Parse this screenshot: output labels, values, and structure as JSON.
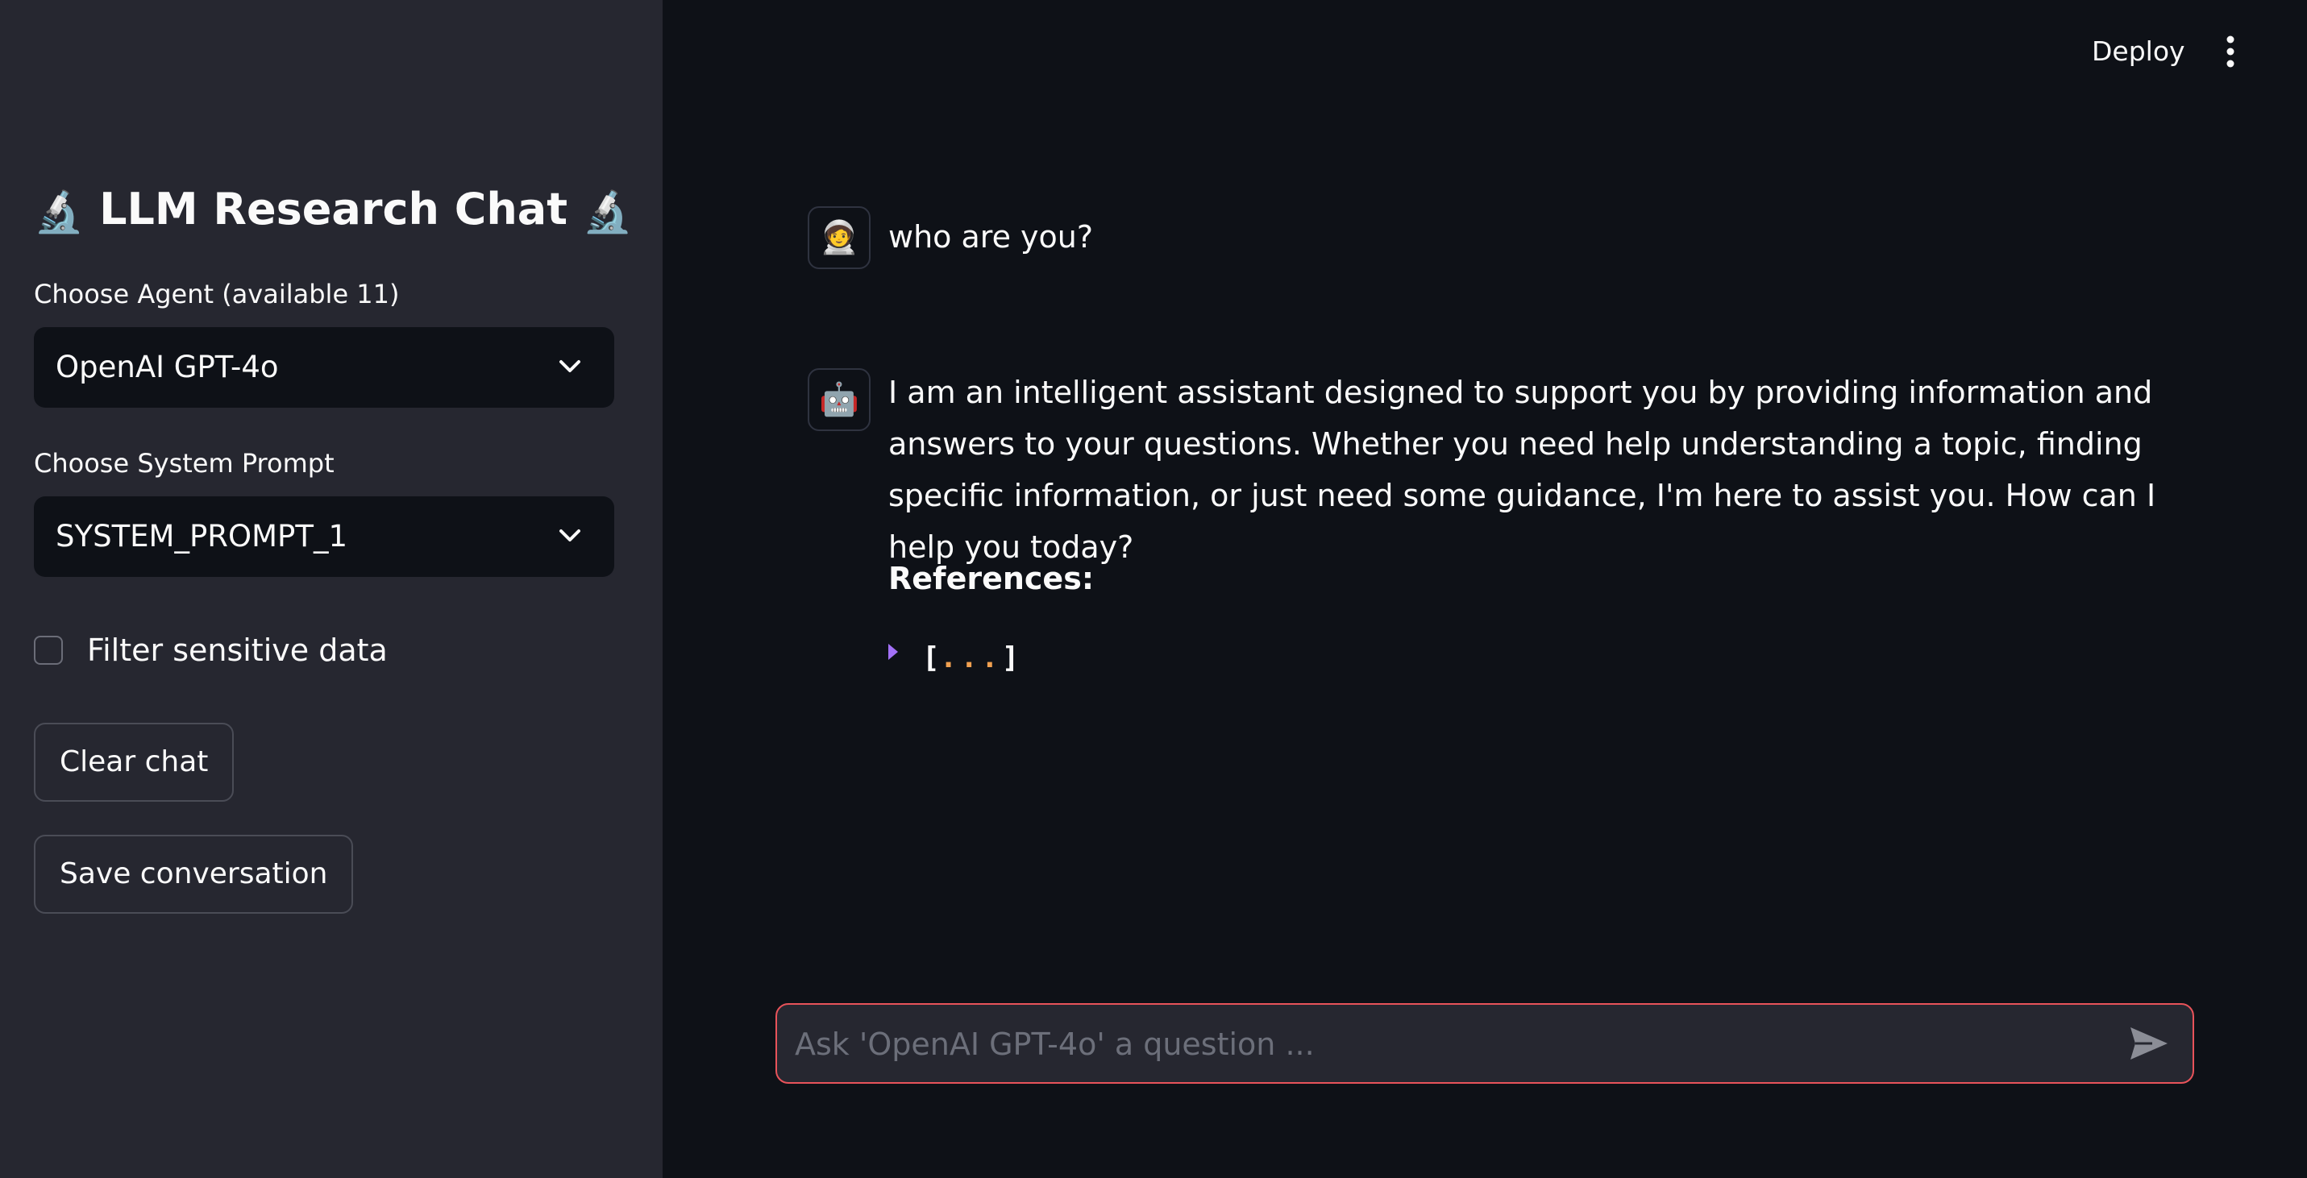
{
  "sidebar": {
    "title": "LLM Research Chat",
    "title_icon": "microscope-icon",
    "agent_label": "Choose Agent (available 11)",
    "agent_value": "OpenAI GPT-4o",
    "prompt_label": "Choose System Prompt",
    "prompt_value": "SYSTEM_PROMPT_1",
    "filter_label": "Filter sensitive data",
    "filter_checked": false,
    "clear_chat_label": "Clear chat",
    "save_conversation_label": "Save conversation"
  },
  "header": {
    "deploy_label": "Deploy",
    "menu_icon": "kebab-menu-icon"
  },
  "chat": {
    "messages": [
      {
        "role": "user",
        "avatar_icon": "astronaut-avatar-icon",
        "text": "who are you?"
      },
      {
        "role": "assistant",
        "avatar_icon": "robot-avatar-icon",
        "text": "I am an intelligent assistant designed to support you by providing information and answers to your questions. Whether you need help understanding a topic, finding specific information, or just need some guidance, I'm here to assist you. How can I help you today?",
        "references_label": "References:",
        "references_open": "[",
        "references_ellipsis": "...",
        "references_close": "]"
      }
    ]
  },
  "chat_input": {
    "placeholder": "Ask 'OpenAI GPT-4o' a question ...",
    "value": "",
    "send_icon": "send-icon"
  },
  "colors": {
    "app_background": "#0e1117",
    "sidebar_background": "#262730",
    "text": "#fafafa",
    "input_border_focus": "#e8535a",
    "caret_accent": "#a371f7",
    "ellipsis_accent": "#f0a050"
  }
}
